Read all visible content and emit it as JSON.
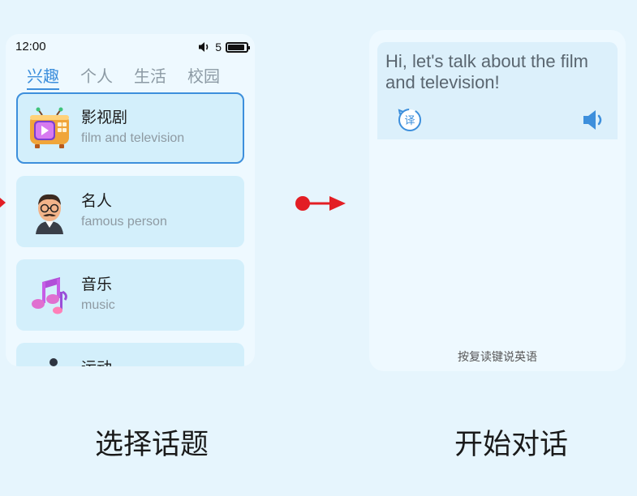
{
  "left_phone": {
    "status": {
      "time": "12:00",
      "volume_level": "5",
      "battery_level": 0.85
    },
    "tabs": [
      {
        "label": "兴趣",
        "active": true
      },
      {
        "label": "个人",
        "active": false
      },
      {
        "label": "生活",
        "active": false
      },
      {
        "label": "校园",
        "active": false
      }
    ],
    "topics": [
      {
        "title": "影视剧",
        "subtitle": "film and television",
        "icon": "tv-icon",
        "selected": true
      },
      {
        "title": "名人",
        "subtitle": "famous person",
        "icon": "famous-person-avatar-icon",
        "selected": false
      },
      {
        "title": "音乐",
        "subtitle": "music",
        "icon": "music-notes-icon",
        "selected": false
      },
      {
        "title": "运动",
        "subtitle": "",
        "icon": "sport-person-icon",
        "selected": false
      }
    ]
  },
  "right_phone": {
    "message": "Hi, let's talk about the film and television!",
    "translate_glyph": "译",
    "hint": "按复读键说英语"
  },
  "captions": {
    "left": "选择话题",
    "right": "开始对话"
  },
  "colors": {
    "background": "#e6f5fd",
    "accent": "#3d8fdc",
    "card": "#d3effb",
    "arrow": "#e31e24"
  }
}
